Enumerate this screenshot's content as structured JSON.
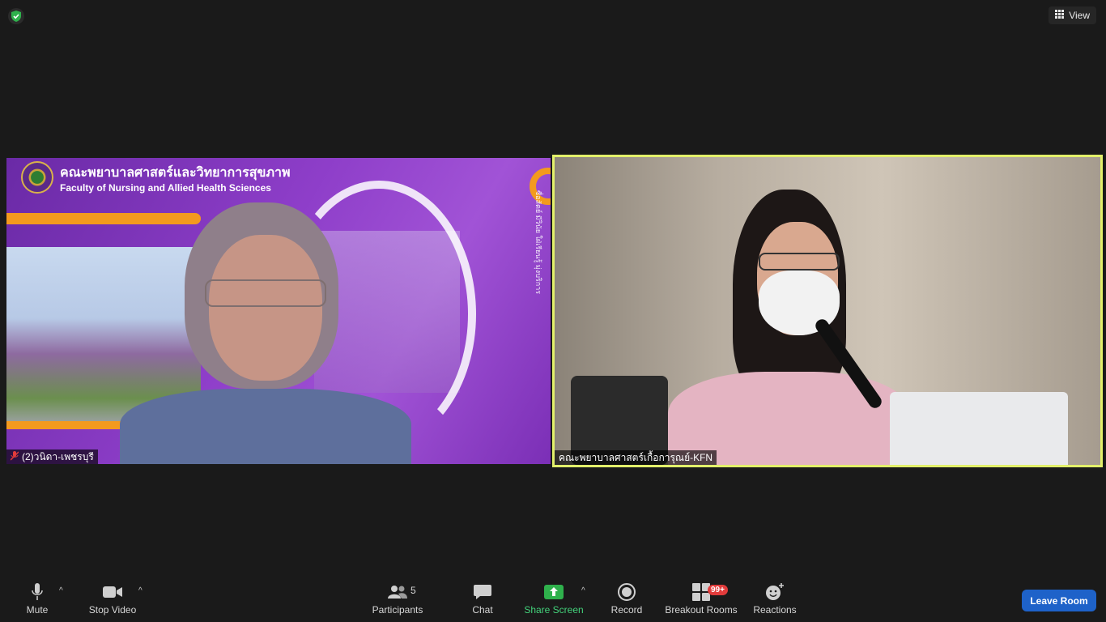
{
  "header": {
    "security_icon": "shield-check-icon",
    "view_label": "View"
  },
  "tiles": [
    {
      "banner_title_th": "คณะพยาบาลศาสตร์และวิทยาการสุขภาพ",
      "banner_title_en": "Faculty of Nursing and Allied Health Sciences",
      "vertical_text": "ซื่อสัตย์ มีวินัย ใฝ่เรียนรู้ มุ่งบริการ",
      "name": "(2)วนิดา-เพชรบุรี",
      "muted": true
    },
    {
      "name": "คณะพยาบาลศาสตร์เกื้อการุณย์-KFN",
      "active_speaker": true,
      "highlight_color": "#e2f06a"
    }
  ],
  "toolbar": {
    "mute_label": "Mute",
    "stop_video_label": "Stop Video",
    "participants_label": "Participants",
    "participants_count": "5",
    "chat_label": "Chat",
    "share_screen_label": "Share Screen",
    "record_label": "Record",
    "breakout_label": "Breakout Rooms",
    "breakout_badge": "99+",
    "reactions_label": "Reactions",
    "leave_label": "Leave Room"
  },
  "colors": {
    "background": "#1a1a1a",
    "share_green": "#43d17a",
    "leave_blue": "#1e62c9",
    "badge_red": "#e23b3b"
  }
}
